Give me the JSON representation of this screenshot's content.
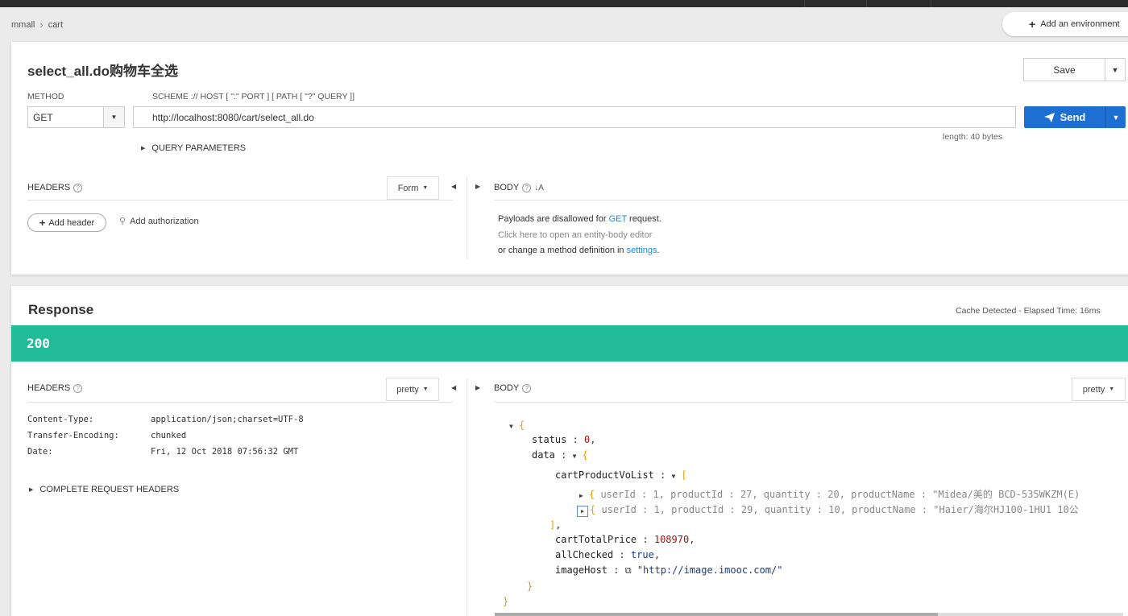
{
  "breadcrumb": {
    "project": "mmall",
    "item": "cart"
  },
  "env_button": {
    "label": "Add an environment"
  },
  "request": {
    "title": "select_all.do购物车全选",
    "save_label": "Save",
    "method_label": "METHOD",
    "method_value": "GET",
    "url_label": "SCHEME :// HOST [ \":\" PORT ] [ PATH [ \"?\" QUERY ]]",
    "url_value": "http://localhost:8080/cart/select_all.do",
    "send_label": "Send",
    "length_text": "length: 40 bytes",
    "query_params_label": "QUERY PARAMETERS",
    "headers_label": "HEADERS",
    "headers_mode": "Form",
    "body_label": "BODY",
    "add_header_label": "Add header",
    "add_auth_label": "Add authorization",
    "body_msg_1a": "Payloads are disallowed for ",
    "body_msg_1b": "GET",
    "body_msg_1c": " request.",
    "body_msg_2": "Click here to open an entity-body editor",
    "body_msg_3a": "or change a method definition in ",
    "body_msg_3b": "settings",
    "body_msg_3c": "."
  },
  "response": {
    "title": "Response",
    "cache_text": "Cache Detected - Elapsed Time: 16ms",
    "status_code": "200",
    "headers_label": "HEADERS",
    "headers_mode": "pretty",
    "body_label": "BODY",
    "body_mode": "pretty",
    "headers": [
      {
        "key": "Content-Type:",
        "value": "application/json;charset=UTF-8"
      },
      {
        "key": "Transfer-Encoding:",
        "value": "chunked"
      },
      {
        "key": "Date:",
        "value": "Fri, 12 Oct 2018 07:56:32 GMT"
      }
    ],
    "complete_headers_label": "COMPLETE REQUEST HEADERS",
    "json": {
      "status_key": "status",
      "status_val": "0",
      "data_key": "data",
      "list_key": "cartProductVoList",
      "item1": {
        "userId": "1",
        "productId": "27",
        "quantity": "20",
        "productName": "\"Midea/美的 BCD-535WKZM(E)"
      },
      "item2": {
        "userId": "1",
        "productId": "29",
        "quantity": "10",
        "productName": "\"Haier/海尔HJ100-1HU1 10公"
      },
      "total_key": "cartTotalPrice",
      "total_val": "108970",
      "checked_key": "allChecked",
      "checked_val": "true",
      "host_key": "imageHost",
      "host_val": "\"http://image.imooc.com/\""
    }
  },
  "colors": {
    "status_green": "#22bb98",
    "send_blue": "#1e6fd2"
  }
}
